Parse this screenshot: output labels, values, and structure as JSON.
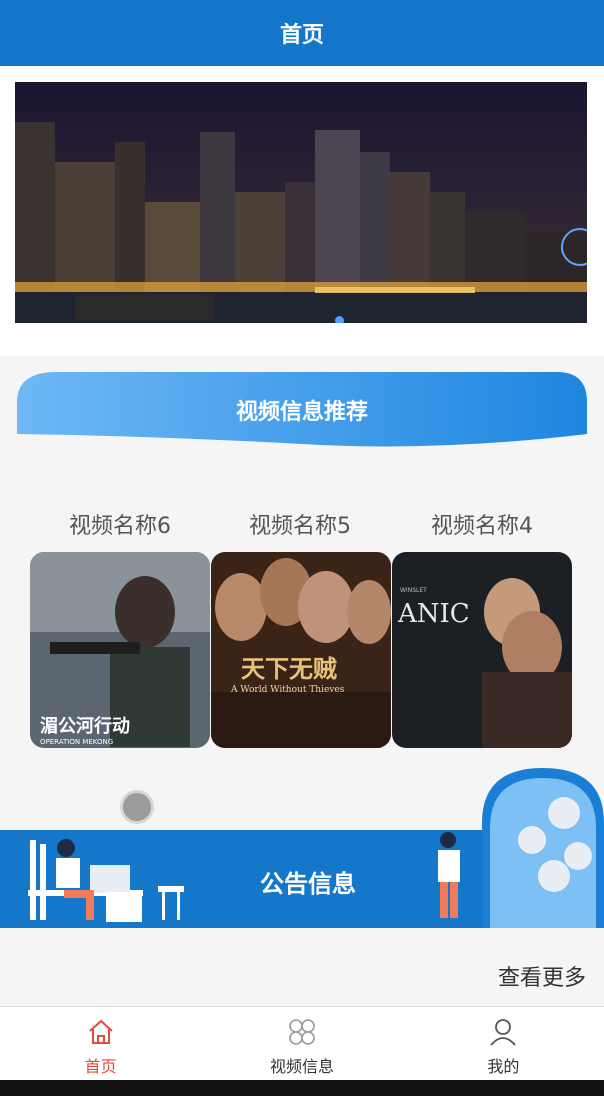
{
  "header": {
    "title": "首页"
  },
  "recommend": {
    "title": "视频信息推荐"
  },
  "videos": [
    {
      "name": "视频名称6",
      "poster_text": "湄公河行动",
      "poster_sub": "OPERATION MEKONG"
    },
    {
      "name": "视频名称5",
      "poster_text": "天下无贼",
      "poster_sub": "A World Without Thieves"
    },
    {
      "name": "视频名称4",
      "poster_text": "ANIC",
      "poster_sub": "WINSLET"
    }
  ],
  "notice": {
    "title": "公告信息"
  },
  "more": {
    "label": "查看更多"
  },
  "tabbar": [
    {
      "label": "首页",
      "icon": "home-icon",
      "active": true
    },
    {
      "label": "视频信息",
      "icon": "grid-icon",
      "active": false
    },
    {
      "label": "我的",
      "icon": "user-icon",
      "active": false
    }
  ],
  "colors": {
    "primary": "#1577c9",
    "active": "#e64b3b"
  }
}
